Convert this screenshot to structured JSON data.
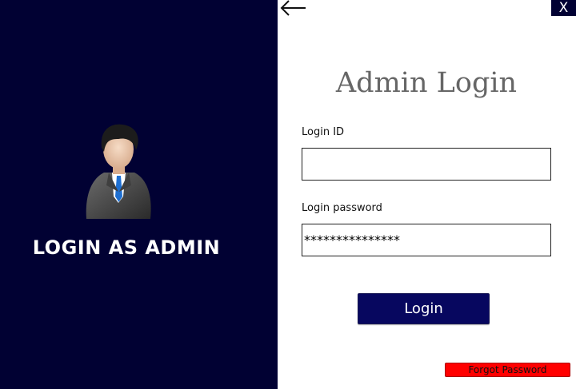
{
  "left_panel": {
    "title": "LOGIN AS ADMIN",
    "avatar_icon": "admin-user-icon"
  },
  "window": {
    "close_label": "X",
    "back_icon": "back-arrow-icon"
  },
  "form": {
    "title": "Admin Login",
    "login_id_label": "Login ID",
    "login_id_value": "",
    "password_label": "Login password",
    "password_value": "***************",
    "login_button": "Login",
    "forgot_button": "Forgot Password"
  },
  "colors": {
    "panel": "#010133",
    "button": "#07075f",
    "forgot": "#ff0000",
    "title": "#666666"
  }
}
